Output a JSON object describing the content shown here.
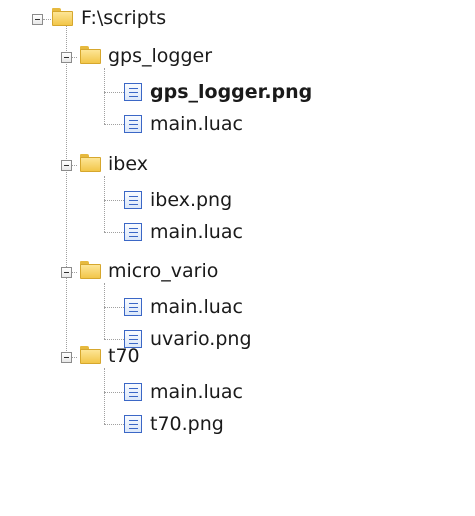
{
  "tree": {
    "root": {
      "label": "F:\\scripts",
      "children": [
        {
          "label": "gps_logger",
          "files": [
            "gps_logger.png",
            "main.luac"
          ],
          "selected_file": "gps_logger.png"
        },
        {
          "label": "ibex",
          "files": [
            "ibex.png",
            "main.luac"
          ]
        },
        {
          "label": "micro_vario",
          "files": [
            "main.luac",
            "uvario.png"
          ]
        },
        {
          "label": "t70",
          "files": [
            "main.luac",
            "t70.png"
          ]
        }
      ]
    }
  },
  "colors": {
    "folder": "#f2c649",
    "file_icon": "#3b67c6",
    "tree_line": "#a0a0a0"
  },
  "icons": {
    "folder": "folder-icon",
    "file": "document-icon",
    "expander": "collapse-minus-icon"
  }
}
